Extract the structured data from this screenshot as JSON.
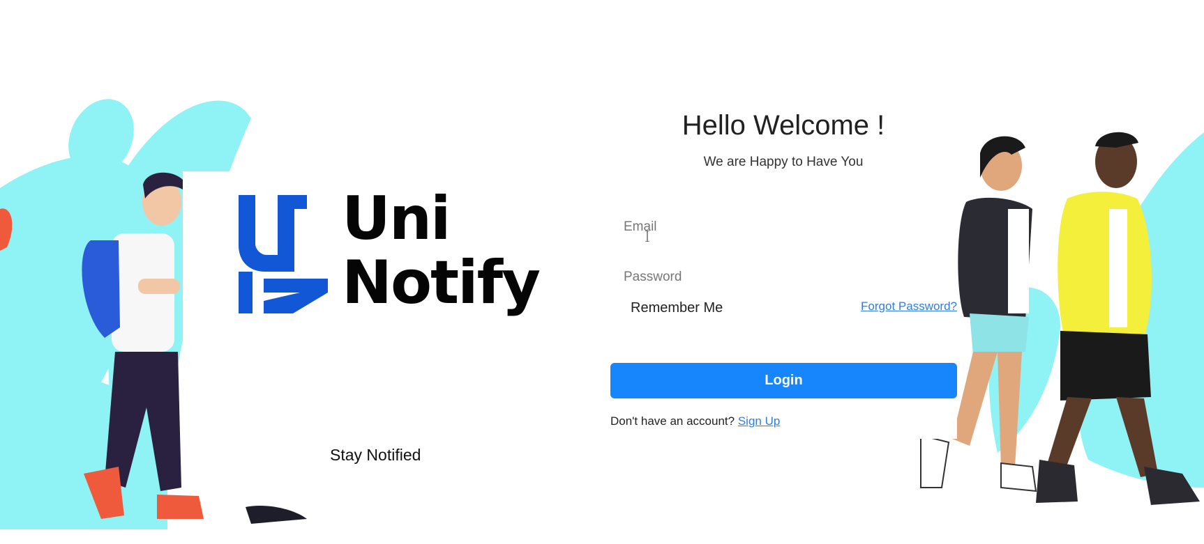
{
  "brand": {
    "logo_line1": "Uni",
    "logo_line2": "Notify",
    "tagline": "Stay Notified",
    "accent_color": "#1257d6"
  },
  "welcome": {
    "title": "Hello Welcome !",
    "subtitle": "We are Happy to Have You"
  },
  "form": {
    "email_placeholder": "Email",
    "password_placeholder": "Password",
    "remember_label": "Remember Me",
    "forgot_label": "Forgot Password?",
    "login_label": "Login",
    "signup_prompt": "Don't have an account?",
    "signup_label": "Sign Up",
    "button_color": "#1785fb",
    "link_color": "#2f7de1"
  },
  "decor": {
    "background_accent": "#8ff2f5",
    "illustrations": [
      "student-with-backpack-illustration",
      "walking-couple-illustration"
    ]
  }
}
